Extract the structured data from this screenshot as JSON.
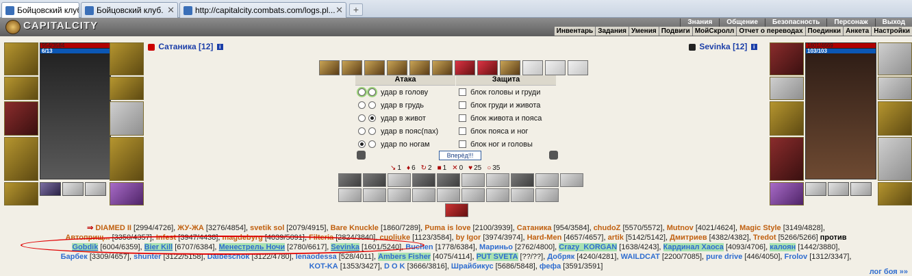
{
  "browser": {
    "tabs": [
      {
        "label": "Бойцовский клуб",
        "active": true
      },
      {
        "label": "Бойцовский клуб.",
        "active": false
      },
      {
        "label": "http://capitalcity.combats.com/logs.pl...",
        "active": false
      }
    ]
  },
  "header": {
    "logo": "CAPITALCITY",
    "top_menu": [
      "Знания",
      "Общение",
      "Безопасность",
      "Персонаж",
      "Выход"
    ],
    "sub_menu": [
      "Инвентарь",
      "Задания",
      "Умения",
      "Подвиги",
      "МойСкролл",
      "Отчет о переводах",
      "Поединки",
      "Анкета",
      "Настройки"
    ]
  },
  "player_left": {
    "name": "Сатаника",
    "level": "[12]",
    "hp": "954/3584",
    "mana": "6/13"
  },
  "player_right": {
    "name": "Sevinka",
    "level": "[12]",
    "hp": "1601/4669",
    "mana": "103/103"
  },
  "combat": {
    "attack_title": "Атака",
    "defense_title": "Защита",
    "attacks": [
      "удар в голову",
      "удар в грудь",
      "удар в живот",
      "удар в пояс(пах)",
      "удар по ногам"
    ],
    "blocks": [
      "блок головы и груди",
      "блок груди и живота",
      "блок живота и пояса",
      "блок пояса и ног",
      "блок ног и головы"
    ],
    "go_button": "Вперёд!!!",
    "stats": [
      "1",
      "6",
      "2",
      "1",
      "0",
      "25",
      "35"
    ]
  },
  "team1": [
    {
      "name": "DIAMED II",
      "hp": "[2994/4726]"
    },
    {
      "name": "ЖУ-ЖА",
      "hp": "[3276/4854]"
    },
    {
      "name": "svetik sol",
      "hp": "[2079/4915]"
    },
    {
      "name": "Bare Knuckle",
      "hp": "[1860/7289]"
    },
    {
      "name": "Puma is love",
      "hp": "[2100/3939]"
    },
    {
      "name": "Сатаника",
      "hp": "[954/3584]"
    },
    {
      "name": "chudoZ",
      "hp": "[5570/5572]"
    },
    {
      "name": "Mutnov",
      "hp": "[4021/4624]"
    },
    {
      "name": "Magic Style",
      "hp": "[3149/4828]"
    },
    {
      "name": "Автоприщ...",
      "hp": "[3350/4357]"
    },
    {
      "name": "Infest",
      "hp": "[3947/4438]"
    },
    {
      "name": "magdebyrg",
      "hp": "[4039/5091]"
    },
    {
      "name": "Filteria",
      "hp": "[2824/3840]"
    },
    {
      "name": "cuoliuke",
      "hp": "[1123/3584]"
    },
    {
      "name": "by Igor",
      "hp": "[3974/3974]"
    },
    {
      "name": "Hard-Men",
      "hp": "[4657/4657]"
    },
    {
      "name": "artik",
      "hp": "[5142/5142]"
    },
    {
      "name": "Дмитриев",
      "hp": "[4382/4382]"
    },
    {
      "name": "Tredot",
      "hp": "[5266/5266]"
    }
  ],
  "versus": "против",
  "team2": [
    {
      "name": "Gobdik",
      "hp": "[6004/6359]"
    },
    {
      "name": "Bier Kill",
      "hp": "[6707/6384]"
    },
    {
      "name": "Менестрель Ночи",
      "hp": "[2780/6617]"
    },
    {
      "name": "Sevinka",
      "hp": "[1601/5240]"
    },
    {
      "name": "Buchen",
      "hp": "[1778/6384]"
    },
    {
      "name": "Мариньо",
      "hp": "[2762/4800]"
    },
    {
      "name": "Crazy_KORGAN",
      "hp": "[1638/4243]"
    },
    {
      "name": "Кардинал Хаоса",
      "hp": "[4093/4706]"
    },
    {
      "name": "калоян",
      "hp": "[1442/3880]"
    },
    {
      "name": "Барбек",
      "hp": "[3309/4657]"
    },
    {
      "name": "shunter",
      "hp": "[3122/5158]"
    },
    {
      "name": "Daibeschok",
      "hp": "[3122/4780]"
    },
    {
      "name": "lenaodessa",
      "hp": "[528/4011]"
    },
    {
      "name": "Ambers Fisher",
      "hp": "[4075/4114]"
    },
    {
      "name": "PUT SVETA",
      "hp": "[??/??]"
    },
    {
      "name": "Добряк",
      "hp": "[4240/4281]"
    },
    {
      "name": "WAILDCAT",
      "hp": "[2200/7085]"
    },
    {
      "name": "pure drive",
      "hp": "[446/4050]"
    },
    {
      "name": "Frolov",
      "hp": "[1312/3347]"
    },
    {
      "name": "KOT-KA",
      "hp": "[1353/3427]"
    },
    {
      "name": "D O K",
      "hp": "[3666/3816]"
    },
    {
      "name": "Шрайбикус",
      "hp": "[5686/5848]"
    },
    {
      "name": "фефа",
      "hp": "[3591/3591]"
    }
  ],
  "more_link": "лог боя »»"
}
